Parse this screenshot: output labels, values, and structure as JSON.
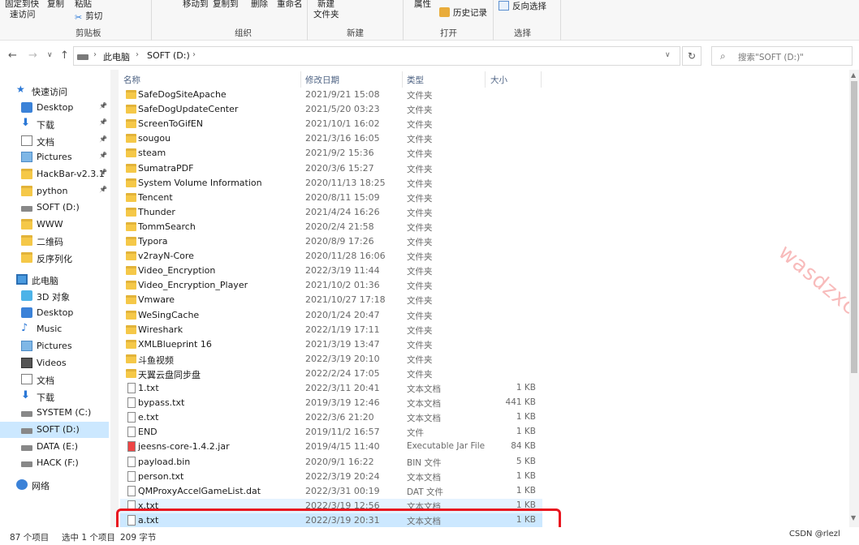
{
  "ribbon": {
    "quick_access_label": "固定到快",
    "quick_access_sub": "速访问",
    "copy_label": "复制",
    "paste_label": "粘贴",
    "cut_label": "剪切",
    "clipboard_group": "剪贴板",
    "move_to_label": "移动到",
    "copy_to_label": "复制到",
    "delete_label": "删除",
    "rename_label": "重命名",
    "organize_group": "组织",
    "new_label": "新建",
    "new_folder_label": "文件夹",
    "new_group": "新建",
    "properties_label": "属性",
    "history_label": "历史记录",
    "open_group": "打开",
    "invert_selection_label": "反向选择",
    "select_group": "选择"
  },
  "address": {
    "crumb_pc": "此电脑",
    "crumb_drive": "SOFT (D:)",
    "search_placeholder": "搜索\"SOFT (D:)\""
  },
  "nav": {
    "quick_access": "快速访问",
    "pinned": [
      {
        "label": "Desktop",
        "icon": "blue"
      },
      {
        "label": "下载",
        "icon": "down"
      },
      {
        "label": "文档",
        "icon": "doc"
      },
      {
        "label": "Pictures",
        "icon": "pic"
      },
      {
        "label": "HackBar-v2.3.1",
        "icon": "folder"
      },
      {
        "label": "python",
        "icon": "folder"
      }
    ],
    "recent": [
      {
        "label": "SOFT (D:)",
        "icon": "drive"
      },
      {
        "label": "WWW",
        "icon": "folder"
      },
      {
        "label": "二维码",
        "icon": "folder"
      },
      {
        "label": "反序列化",
        "icon": "folder"
      }
    ],
    "this_pc": "此电脑",
    "pc_items": [
      {
        "label": "3D 对象",
        "icon": "3d"
      },
      {
        "label": "Desktop",
        "icon": "blue"
      },
      {
        "label": "Music",
        "icon": "music"
      },
      {
        "label": "Pictures",
        "icon": "pic"
      },
      {
        "label": "Videos",
        "icon": "vid"
      },
      {
        "label": "文档",
        "icon": "doc"
      },
      {
        "label": "下载",
        "icon": "down"
      },
      {
        "label": "SYSTEM (C:)",
        "icon": "drive"
      },
      {
        "label": "SOFT (D:)",
        "icon": "drive"
      },
      {
        "label": "DATA (E:)",
        "icon": "drive"
      },
      {
        "label": "HACK (F:)",
        "icon": "drive"
      }
    ],
    "network": "网络"
  },
  "columns": {
    "name": "名称",
    "date": "修改日期",
    "type": "类型",
    "size": "大小"
  },
  "files": [
    {
      "name": "SafeDogSiteApache",
      "date": "2021/9/21 15:08",
      "type": "文件夹",
      "size": "",
      "kind": "folder"
    },
    {
      "name": "SafeDogUpdateCenter",
      "date": "2021/5/20 03:23",
      "type": "文件夹",
      "size": "",
      "kind": "folder"
    },
    {
      "name": "ScreenToGifEN",
      "date": "2021/10/1 16:02",
      "type": "文件夹",
      "size": "",
      "kind": "folder"
    },
    {
      "name": "sougou",
      "date": "2021/3/16 16:05",
      "type": "文件夹",
      "size": "",
      "kind": "folder"
    },
    {
      "name": "steam",
      "date": "2021/9/2 15:36",
      "type": "文件夹",
      "size": "",
      "kind": "folder"
    },
    {
      "name": "SumatraPDF",
      "date": "2020/3/6 15:27",
      "type": "文件夹",
      "size": "",
      "kind": "folder"
    },
    {
      "name": "System Volume Information",
      "date": "2020/11/13 18:25",
      "type": "文件夹",
      "size": "",
      "kind": "folder"
    },
    {
      "name": "Tencent",
      "date": "2020/8/11 15:09",
      "type": "文件夹",
      "size": "",
      "kind": "folder"
    },
    {
      "name": "Thunder",
      "date": "2021/4/24 16:26",
      "type": "文件夹",
      "size": "",
      "kind": "folder"
    },
    {
      "name": "TommSearch",
      "date": "2020/2/4 21:58",
      "type": "文件夹",
      "size": "",
      "kind": "folder"
    },
    {
      "name": "Typora",
      "date": "2020/8/9 17:26",
      "type": "文件夹",
      "size": "",
      "kind": "folder"
    },
    {
      "name": "v2rayN-Core",
      "date": "2020/11/28 16:06",
      "type": "文件夹",
      "size": "",
      "kind": "folder"
    },
    {
      "name": "Video_Encryption",
      "date": "2022/3/19 11:44",
      "type": "文件夹",
      "size": "",
      "kind": "folder"
    },
    {
      "name": "Video_Encryption_Player",
      "date": "2021/10/2 01:36",
      "type": "文件夹",
      "size": "",
      "kind": "folder"
    },
    {
      "name": "Vmware",
      "date": "2021/10/27 17:18",
      "type": "文件夹",
      "size": "",
      "kind": "folder"
    },
    {
      "name": "WeSingCache",
      "date": "2020/1/24 20:47",
      "type": "文件夹",
      "size": "",
      "kind": "folder"
    },
    {
      "name": "Wireshark",
      "date": "2022/1/19 17:11",
      "type": "文件夹",
      "size": "",
      "kind": "folder"
    },
    {
      "name": "XMLBlueprint 16",
      "date": "2021/3/19 13:47",
      "type": "文件夹",
      "size": "",
      "kind": "folder"
    },
    {
      "name": "斗鱼视频",
      "date": "2022/3/19 20:10",
      "type": "文件夹",
      "size": "",
      "kind": "folder"
    },
    {
      "name": "天翼云盘同步盘",
      "date": "2022/2/24 17:05",
      "type": "文件夹",
      "size": "",
      "kind": "folder"
    },
    {
      "name": "1.txt",
      "date": "2022/3/11 20:41",
      "type": "文本文档",
      "size": "1 KB",
      "kind": "file"
    },
    {
      "name": "bypass.txt",
      "date": "2019/3/19 12:46",
      "type": "文本文档",
      "size": "441 KB",
      "kind": "file"
    },
    {
      "name": "e.txt",
      "date": "2022/3/6 21:20",
      "type": "文本文档",
      "size": "1 KB",
      "kind": "file"
    },
    {
      "name": "END",
      "date": "2019/11/2 16:57",
      "type": "文件",
      "size": "1 KB",
      "kind": "file"
    },
    {
      "name": "jeesns-core-1.4.2.jar",
      "date": "2019/4/15 11:40",
      "type": "Executable Jar File",
      "size": "84 KB",
      "kind": "jar"
    },
    {
      "name": "payload.bin",
      "date": "2020/9/1 16:22",
      "type": "BIN 文件",
      "size": "5 KB",
      "kind": "file"
    },
    {
      "name": "person.txt",
      "date": "2022/3/19 20:24",
      "type": "文本文档",
      "size": "1 KB",
      "kind": "file"
    },
    {
      "name": "QMProxyAccelGameList.dat",
      "date": "2022/3/31 00:19",
      "type": "DAT 文件",
      "size": "1 KB",
      "kind": "file"
    },
    {
      "name": "x.txt",
      "date": "2022/3/19 12:56",
      "type": "文本文档",
      "size": "1 KB",
      "kind": "file",
      "state": "hl"
    },
    {
      "name": "a.txt",
      "date": "2022/3/19 20:31",
      "type": "文本文档",
      "size": "1 KB",
      "kind": "file",
      "state": "sel"
    }
  ],
  "status": {
    "count": "87 个项目",
    "selected": "选中 1 个项目",
    "bytes": "209 字节"
  },
  "watermark": "wasdzxc",
  "footer_credit": "CSDN @rlezl",
  "colors": {
    "selection": "#cce8ff",
    "hover": "#e5f3ff",
    "highlight_box": "#e8151f",
    "folder": "#f5c848"
  }
}
